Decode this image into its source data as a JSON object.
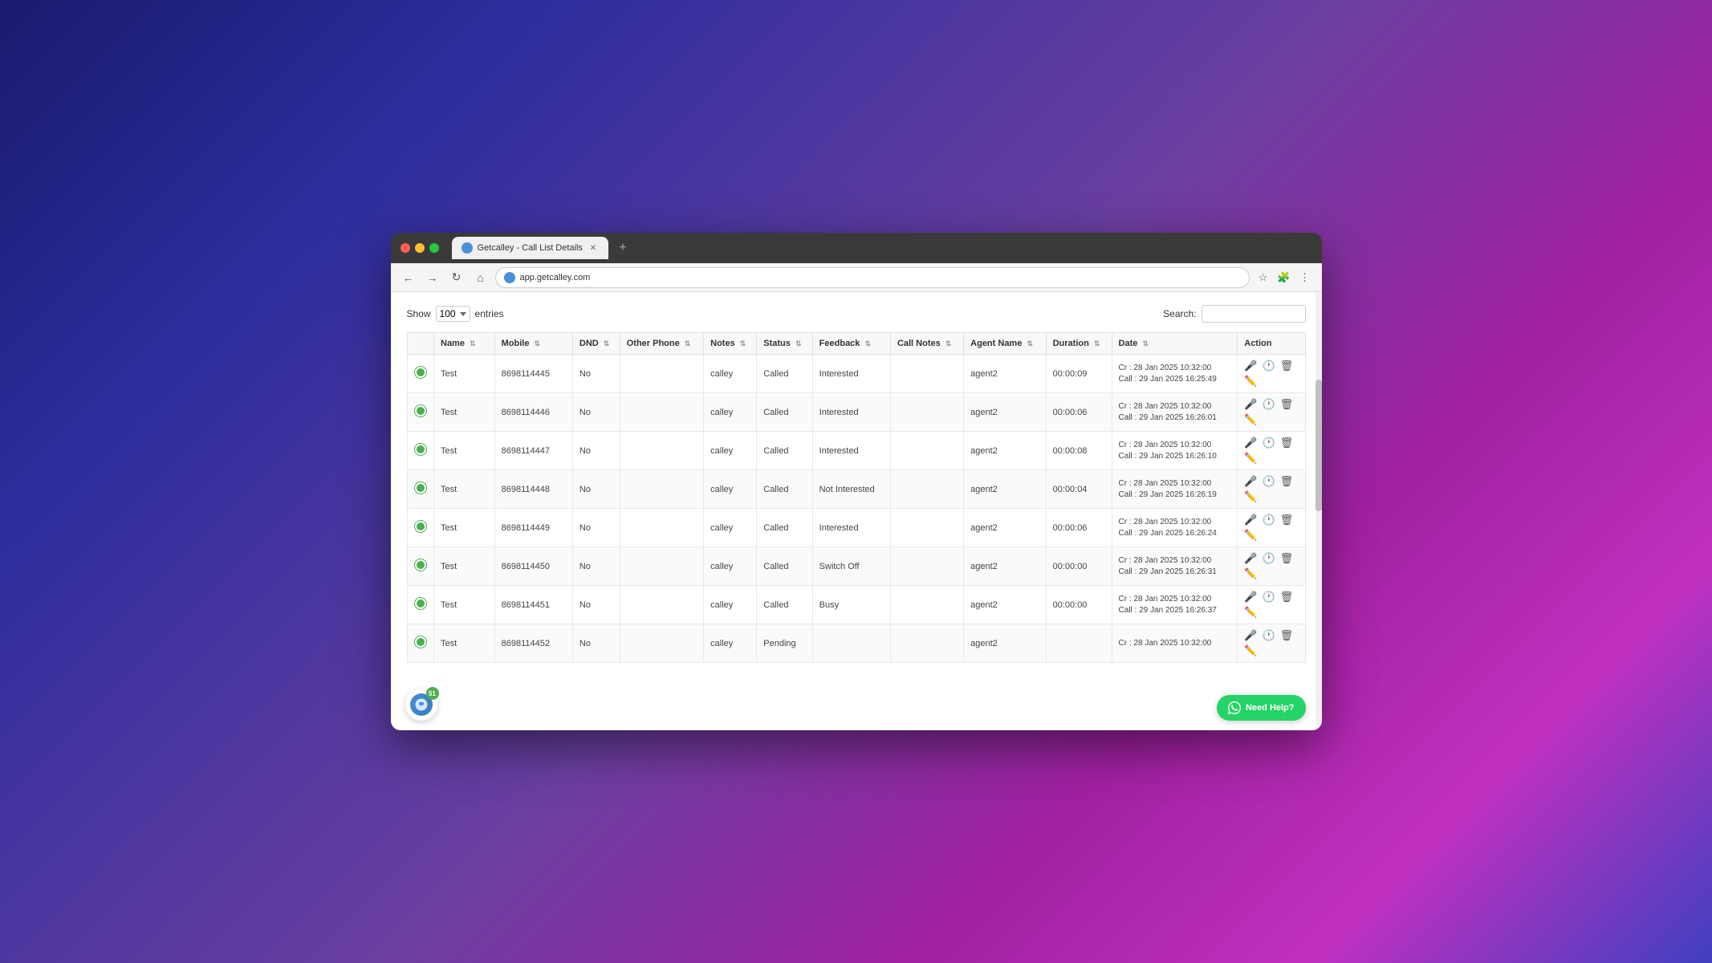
{
  "browser": {
    "tab_title": "Getcalley - Call List Details",
    "address": "app.getcalley.com",
    "new_tab_label": "+"
  },
  "page": {
    "show_label": "Show",
    "entries_value": "100",
    "entries_label": "entries",
    "search_label": "Search:"
  },
  "table": {
    "columns": [
      {
        "label": "",
        "key": "indicator"
      },
      {
        "label": "Name",
        "key": "name"
      },
      {
        "label": "Mobile",
        "key": "mobile"
      },
      {
        "label": "DND",
        "key": "dnd"
      },
      {
        "label": "Other Phone",
        "key": "other_phone"
      },
      {
        "label": "Notes",
        "key": "notes"
      },
      {
        "label": "Status",
        "key": "status"
      },
      {
        "label": "Feedback",
        "key": "feedback"
      },
      {
        "label": "Call Notes",
        "key": "call_notes"
      },
      {
        "label": "Agent Name",
        "key": "agent_name"
      },
      {
        "label": "Duration",
        "key": "duration"
      },
      {
        "label": "Date",
        "key": "date"
      },
      {
        "label": "Action",
        "key": "action"
      }
    ],
    "rows": [
      {
        "name": "Test",
        "mobile": "8698114445",
        "dnd": "No",
        "other_phone": "",
        "notes": "calley",
        "status": "Called",
        "feedback": "Interested",
        "call_notes": "",
        "agent_name": "agent2",
        "duration": "00:00:09",
        "cr_date": "Cr : 28 Jan 2025 10:32:00",
        "call_date": "Call : 29 Jan 2025 16:25:49"
      },
      {
        "name": "Test",
        "mobile": "8698114446",
        "dnd": "No",
        "other_phone": "",
        "notes": "calley",
        "status": "Called",
        "feedback": "Interested",
        "call_notes": "",
        "agent_name": "agent2",
        "duration": "00:00:06",
        "cr_date": "Cr : 28 Jan 2025 10:32:00",
        "call_date": "Call : 29 Jan 2025 16:26:01"
      },
      {
        "name": "Test",
        "mobile": "8698114447",
        "dnd": "No",
        "other_phone": "",
        "notes": "calley",
        "status": "Called",
        "feedback": "Interested",
        "call_notes": "",
        "agent_name": "agent2",
        "duration": "00:00:08",
        "cr_date": "Cr : 28 Jan 2025 10:32:00",
        "call_date": "Call : 29 Jan 2025 16:26:10"
      },
      {
        "name": "Test",
        "mobile": "8698114448",
        "dnd": "No",
        "other_phone": "",
        "notes": "calley",
        "status": "Called",
        "feedback": "Not Interested",
        "call_notes": "",
        "agent_name": "agent2",
        "duration": "00:00:04",
        "cr_date": "Cr : 28 Jan 2025 10:32:00",
        "call_date": "Call : 29 Jan 2025 16:26:19"
      },
      {
        "name": "Test",
        "mobile": "8698114449",
        "dnd": "No",
        "other_phone": "",
        "notes": "calley",
        "status": "Called",
        "feedback": "Interested",
        "call_notes": "",
        "agent_name": "agent2",
        "duration": "00:00:06",
        "cr_date": "Cr : 28 Jan 2025 10:32:00",
        "call_date": "Call : 29 Jan 2025 16:26:24"
      },
      {
        "name": "Test",
        "mobile": "8698114450",
        "dnd": "No",
        "other_phone": "",
        "notes": "calley",
        "status": "Called",
        "feedback": "Switch Off",
        "call_notes": "",
        "agent_name": "agent2",
        "duration": "00:00:00",
        "cr_date": "Cr : 28 Jan 2025 10:32:00",
        "call_date": "Call : 29 Jan 2025 16:26:31"
      },
      {
        "name": "Test",
        "mobile": "8698114451",
        "dnd": "No",
        "other_phone": "",
        "notes": "calley",
        "status": "Called",
        "feedback": "Busy",
        "call_notes": "",
        "agent_name": "agent2",
        "duration": "00:00:00",
        "cr_date": "Cr : 28 Jan 2025 10:32:00",
        "call_date": "Call : 29 Jan 2025 16:26:37"
      },
      {
        "name": "Test",
        "mobile": "8698114452",
        "dnd": "No",
        "other_phone": "",
        "notes": "calley",
        "status": "Pending",
        "feedback": "",
        "call_notes": "",
        "agent_name": "agent2",
        "duration": "",
        "cr_date": "Cr : 28 Jan 2025 10:32:00",
        "call_date": ""
      }
    ]
  },
  "floating": {
    "notification_count": "51",
    "need_help_label": "Need Help?"
  }
}
